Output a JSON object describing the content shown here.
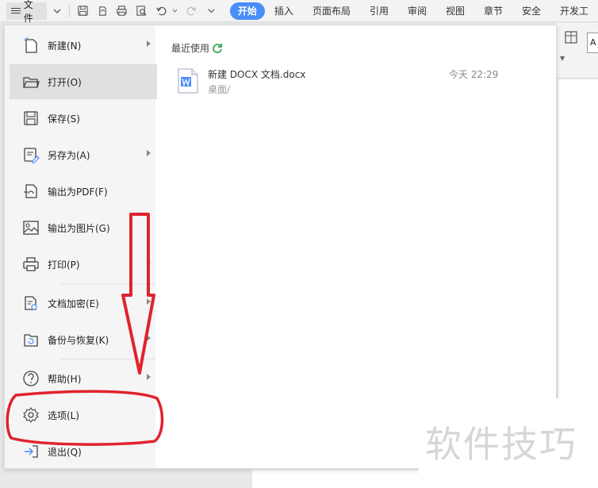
{
  "toolbar": {
    "file_label": "文件",
    "tabs": [
      {
        "label": "开始",
        "active": true
      },
      {
        "label": "插入"
      },
      {
        "label": "页面布局"
      },
      {
        "label": "引用"
      },
      {
        "label": "审阅"
      },
      {
        "label": "视图"
      },
      {
        "label": "章节"
      },
      {
        "label": "安全"
      },
      {
        "label": "开发工"
      }
    ],
    "accent_color": "#4a8df8"
  },
  "ribbon_partial": {
    "letter": "A"
  },
  "file_menu": {
    "items": [
      {
        "label": "新建(N)",
        "icon": "new-doc-icon",
        "has_submenu": true
      },
      {
        "label": "打开(O)",
        "icon": "folder-open-icon",
        "selected": true
      },
      {
        "label": "保存(S)",
        "icon": "save-icon"
      },
      {
        "label": "另存为(A)",
        "icon": "save-as-icon",
        "has_submenu": true
      },
      {
        "label": "输出为PDF(F)",
        "icon": "export-pdf-icon"
      },
      {
        "label": "输出为图片(G)",
        "icon": "export-image-icon"
      },
      {
        "label": "打印(P)",
        "icon": "print-icon",
        "has_submenu": true
      },
      {
        "label": "文档加密(E)",
        "icon": "encrypt-doc-icon",
        "has_submenu": true
      },
      {
        "label": "备份与恢复(K)",
        "icon": "backup-restore-icon",
        "has_submenu": true
      },
      {
        "label": "帮助(H)",
        "icon": "help-icon",
        "has_submenu": true
      },
      {
        "label": "选项(L)",
        "icon": "gear-icon"
      },
      {
        "label": "退出(Q)",
        "icon": "exit-icon"
      }
    ]
  },
  "recent": {
    "title": "最近使用",
    "files": [
      {
        "name": "新建 DOCX 文档.docx",
        "path": "桌面/",
        "time": "今天 22:29"
      }
    ]
  },
  "annotation_color": "#e0232e",
  "watermark": "软件技巧"
}
